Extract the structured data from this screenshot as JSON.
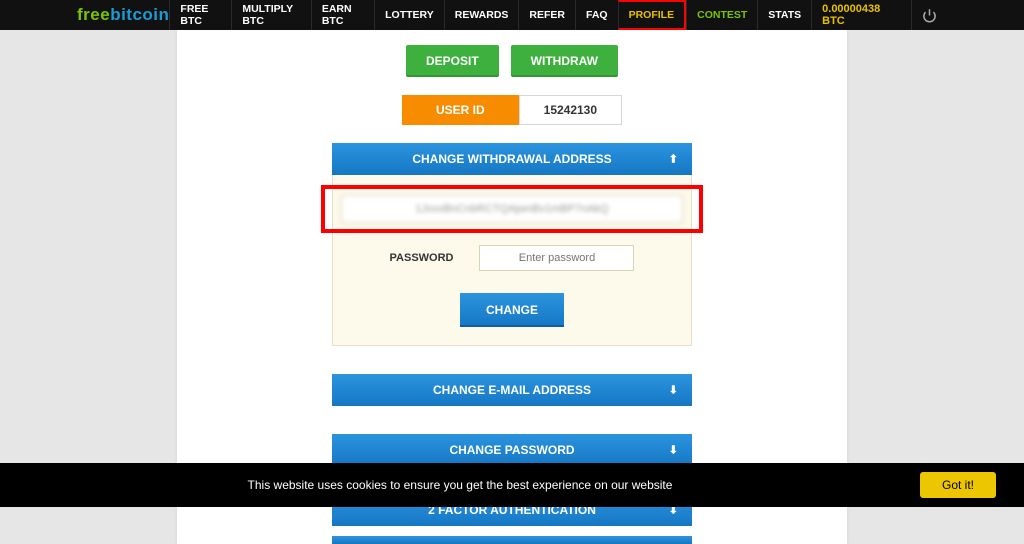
{
  "logo": {
    "part1": "free",
    "part2": "bitcoin"
  },
  "nav": {
    "free_btc": "FREE BTC",
    "multiply_btc": "MULTIPLY BTC",
    "earn_btc": "EARN BTC",
    "lottery": "LOTTERY",
    "rewards": "REWARDS",
    "refer": "REFER",
    "faq": "FAQ",
    "profile": "PROFILE",
    "contest": "CONTEST",
    "stats": "STATS"
  },
  "balance": "0.00000438 BTC",
  "buttons": {
    "deposit": "DEPOSIT",
    "withdraw": "WITHDRAW"
  },
  "userid": {
    "label": "USER ID",
    "value": "15242130"
  },
  "panels": {
    "withdrawal": "CHANGE WITHDRAWAL ADDRESS",
    "email": "CHANGE E-MAIL ADDRESS",
    "password": "CHANGE PASSWORD",
    "twofa": "2 FACTOR AUTHENTICATION"
  },
  "form": {
    "address_value": "1JxxxBnCnbRCTQAjwnBv1mBP7nAkQ",
    "password_label": "PASSWORD",
    "password_placeholder": "Enter password",
    "change": "CHANGE"
  },
  "arrows": {
    "up": "⬆",
    "down": "⬇"
  },
  "cookie": {
    "text": "This website uses cookies to ensure you get the best experience on our website",
    "btn": "Got it!"
  }
}
